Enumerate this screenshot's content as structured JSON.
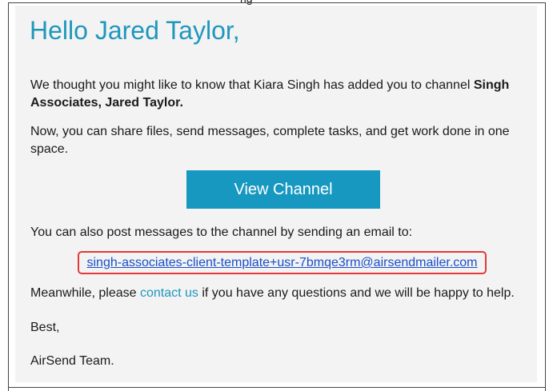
{
  "email": {
    "crop_text": "ng",
    "greeting": "Hello Jared Taylor,",
    "p1_prefix": "We thought you might like to know that Kiara Singh has added you to channel ",
    "p1_channel": "Singh Associates, Jared Taylor.",
    "p2": "Now, you can share files, send messages, complete tasks, and get work done in one space.",
    "button_label": "View Channel",
    "p4": "You can also post messages to the channel by sending an email to:",
    "channel_email": "singh-associates-client-template+usr-7bmqe3rm@airsendmailer.com",
    "p5_prefix": "Meanwhile, please ",
    "contact_link": "contact us",
    "p5_suffix": " if you have any questions and we will be happy to help.",
    "signoff": "Best,",
    "team": "AirSend Team."
  },
  "colors": {
    "accent": "#1f97bd",
    "button": "#1698c1",
    "link": "#1a4fc9",
    "highlight": "#e23a3a",
    "card_bg": "#f3f3f3"
  }
}
